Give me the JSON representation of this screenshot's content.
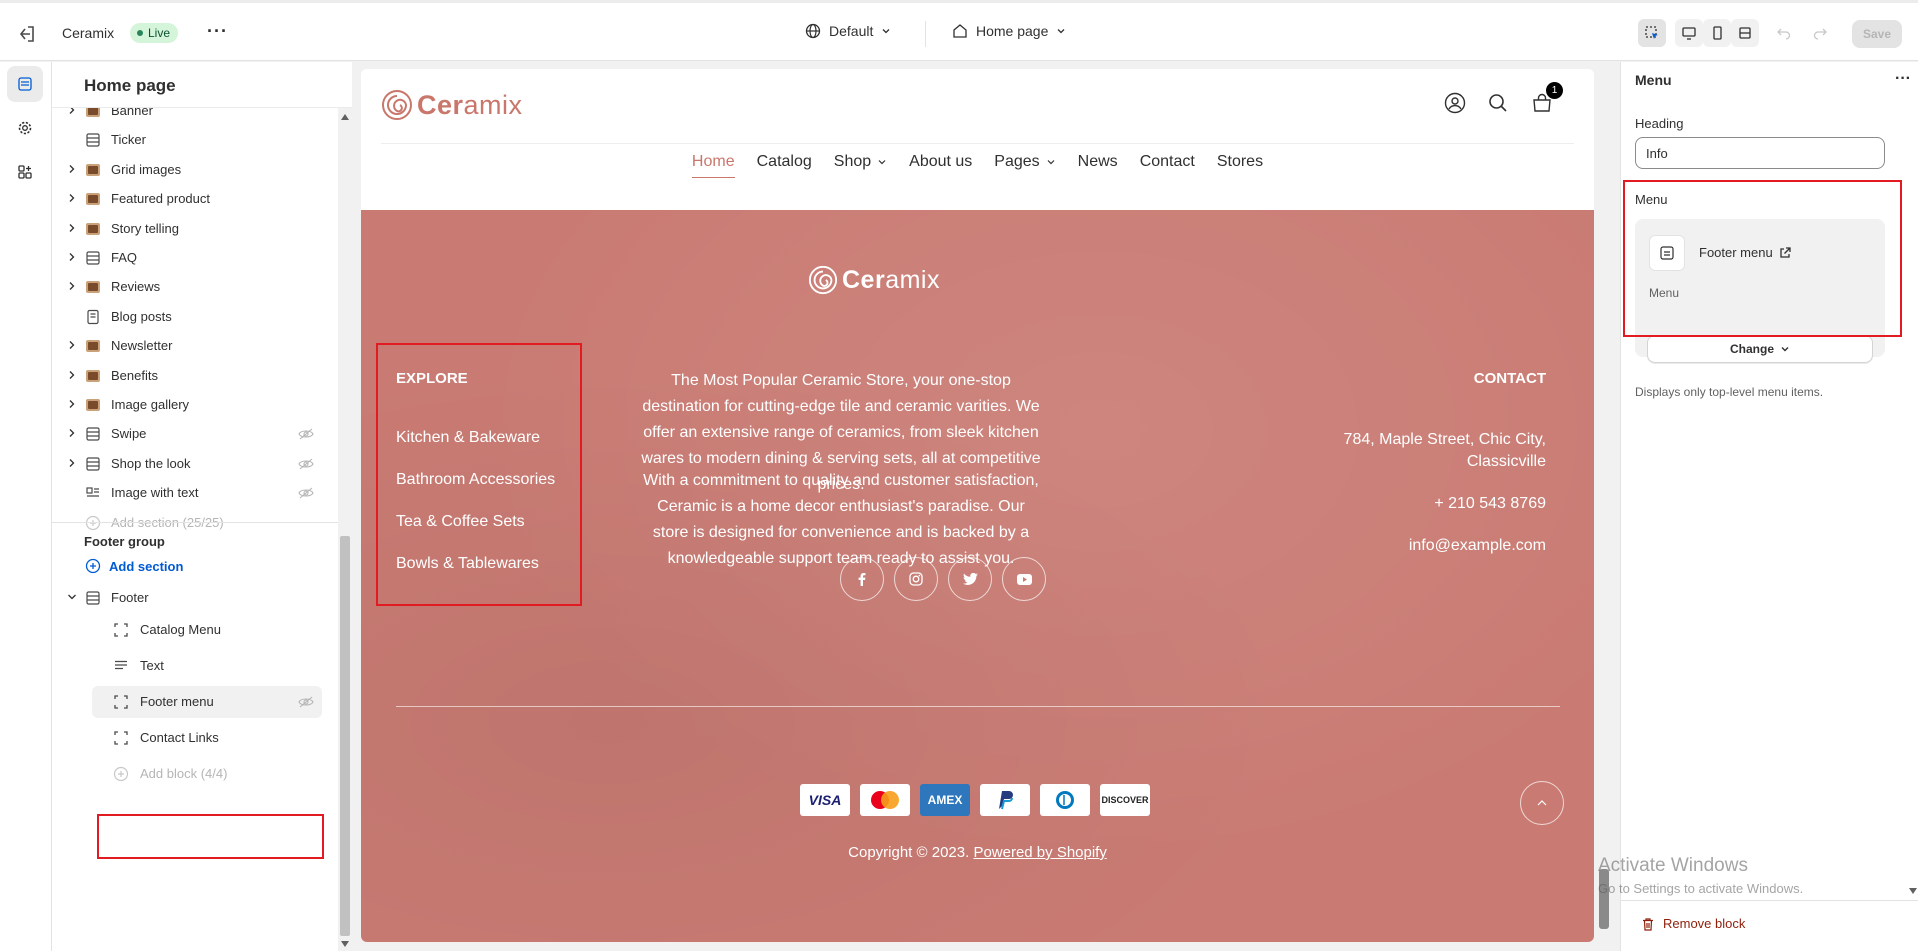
{
  "topbar": {
    "store_name": "Ceramix",
    "status": "Live",
    "theme_select": "Default",
    "page_select": "Home page",
    "save_label": "Save"
  },
  "sidebar": {
    "title": "Home page",
    "sections": [
      {
        "label": "Banner",
        "icon": "image-thumb",
        "expandable": true,
        "hidden": false
      },
      {
        "label": "Ticker",
        "icon": "layout-rows-icon",
        "expandable": false,
        "hidden": false
      },
      {
        "label": "Grid images",
        "icon": "image-thumb",
        "expandable": true,
        "hidden": false
      },
      {
        "label": "Featured product",
        "icon": "image-thumb",
        "expandable": true,
        "hidden": false
      },
      {
        "label": "Story telling",
        "icon": "image-thumb",
        "expandable": true,
        "hidden": false
      },
      {
        "label": "FAQ",
        "icon": "layout-rows-icon",
        "expandable": true,
        "hidden": false
      },
      {
        "label": "Reviews",
        "icon": "image-thumb",
        "expandable": true,
        "hidden": false
      },
      {
        "label": "Blog posts",
        "icon": "blog-icon",
        "expandable": false,
        "hidden": false
      },
      {
        "label": "Newsletter",
        "icon": "image-thumb",
        "expandable": true,
        "hidden": false
      },
      {
        "label": "Benefits",
        "icon": "image-thumb",
        "expandable": true,
        "hidden": false
      },
      {
        "label": "Image gallery",
        "icon": "image-thumb",
        "expandable": true,
        "hidden": false
      },
      {
        "label": "Swipe",
        "icon": "layout-rows-icon",
        "expandable": true,
        "hidden": true
      },
      {
        "label": "Shop the look",
        "icon": "layout-rows-icon",
        "expandable": true,
        "hidden": true
      },
      {
        "label": "Image with text",
        "icon": "image-text-icon",
        "expandable": false,
        "hidden": true
      }
    ],
    "add_section": "Add section (25/25)",
    "footer_group_title": "Footer group",
    "footer_add_section": "Add section",
    "footer_section": "Footer",
    "footer_blocks": [
      {
        "label": "Catalog Menu",
        "icon": "block-icon",
        "hidden": false
      },
      {
        "label": "Text",
        "icon": "text-icon",
        "hidden": false
      },
      {
        "label": "Footer menu",
        "icon": "block-icon",
        "hidden": true
      },
      {
        "label": "Contact Links",
        "icon": "block-icon",
        "hidden": false
      }
    ],
    "add_block": "Add block (4/4)"
  },
  "preview": {
    "logo_text_a": "Cer",
    "logo_text_b": "amix",
    "cart_count": "1",
    "nav": [
      "Home",
      "Catalog",
      "Shop",
      "About us",
      "Pages",
      "News",
      "Contact",
      "Stores"
    ],
    "footer": {
      "explore_heading": "EXPLORE",
      "explore_links": [
        "Kitchen & Bakeware",
        "Bathroom Accessories",
        "Tea & Coffee Sets",
        "Bowls & Tablewares"
      ],
      "about_p1": "The Most Popular Ceramic Store, your one-stop destination for cutting-edge tile and ceramic varities. We offer an extensive range of ceramics, from sleek kitchen wares to modern dining & serving sets, all at competitive prices.",
      "about_p2": "With a commitment to quality and customer satisfaction, Ceramic is a home decor enthusiast's paradise. Our store is designed for convenience and is backed by a knowledgeable support team ready to assist you.",
      "contact_heading": "CONTACT",
      "address_1": "784, Maple Street, Chic City,",
      "address_2": "Classicville",
      "phone": "+ 210 543 8769",
      "email": "info@example.com",
      "social": [
        "facebook-icon",
        "instagram-icon",
        "twitter-icon",
        "youtube-icon"
      ],
      "payments": [
        "VISA",
        "Mastercard",
        "AMEX",
        "PayPal",
        "Diners",
        "DISCOVER"
      ],
      "copyright": "Copyright © 2023.",
      "powered": "Powered by Shopify"
    }
  },
  "rpanel": {
    "title": "Menu",
    "heading_label": "Heading",
    "heading_value": "Info",
    "menu_label": "Menu",
    "menu_name": "Footer menu",
    "menu_sub": "Menu",
    "change_label": "Change",
    "help": "Displays only top-level menu items.",
    "remove": "Remove block"
  },
  "watermark": {
    "line1": "Activate Windows",
    "line2": "Go to Settings to activate Windows."
  },
  "colors": {
    "footer_bg": "#c97b73",
    "accent": "#c9766b",
    "highlight": "#e21b23"
  }
}
